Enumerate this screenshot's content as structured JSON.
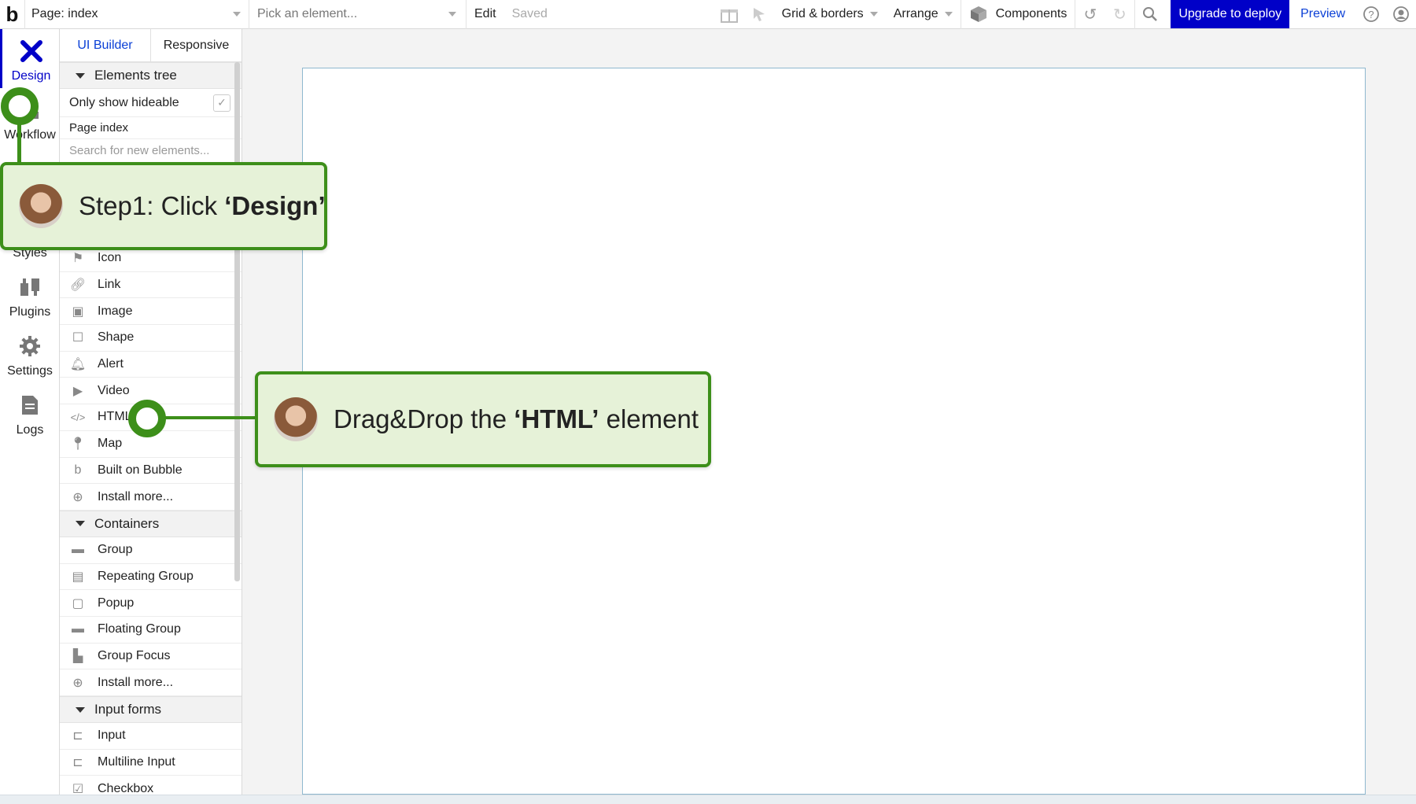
{
  "topbar": {
    "logo": "b",
    "page_selector": "Page: index",
    "element_picker_placeholder": "Pick an element...",
    "edit_label": "Edit",
    "saved_label": "Saved",
    "grid_label": "Grid & borders",
    "arrange_label": "Arrange",
    "components_label": "Components",
    "upgrade_label": "Upgrade to deploy",
    "preview_label": "Preview",
    "accent_color": "#0000c8"
  },
  "leftnav": {
    "items": [
      {
        "label": "Design",
        "icon": "design-icon"
      },
      {
        "label": "Workflow",
        "icon": "workflow-icon"
      },
      {
        "label": "Styles",
        "icon": "styles-icon"
      },
      {
        "label": "Plugins",
        "icon": "plugins-icon"
      },
      {
        "label": "Settings",
        "icon": "gear-icon"
      },
      {
        "label": "Logs",
        "icon": "logs-icon"
      }
    ]
  },
  "panel": {
    "tab_ui_builder": "UI Builder",
    "tab_responsive": "Responsive",
    "elements_tree": "Elements tree",
    "only_show_hideable": "Only show hideable",
    "page_index": "Page index",
    "search_placeholder": "Search for new elements...",
    "visual_elements": [
      "Icon",
      "Link",
      "Image",
      "Shape",
      "Alert",
      "Video",
      "HTML",
      "Map",
      "Built on Bubble",
      "Install more..."
    ],
    "containers_header": "Containers",
    "containers": [
      "Group",
      "Repeating Group",
      "Popup",
      "Floating Group",
      "Group Focus",
      "Install more..."
    ],
    "input_forms_header": "Input forms",
    "input_forms": [
      "Input",
      "Multiline Input",
      "Checkbox"
    ]
  },
  "callouts": {
    "step1_prefix": "Step1: Click ",
    "step1_bold": "‘Design’",
    "step2_prefix": "Drag&Drop the ",
    "step2_bold": "‘HTML’",
    "step2_suffix": " element",
    "color": "#3d8f1a"
  }
}
